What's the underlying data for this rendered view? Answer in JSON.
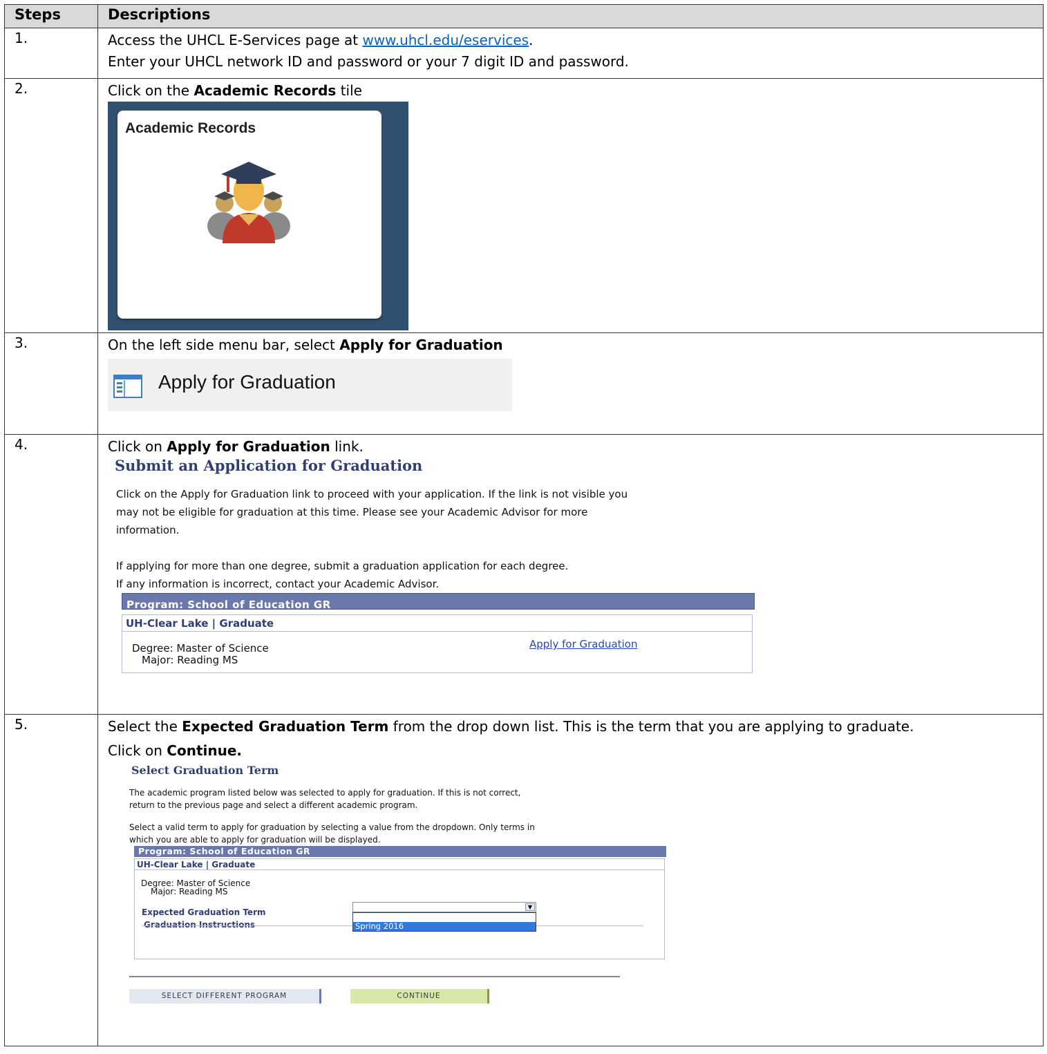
{
  "header": {
    "steps": "Steps",
    "descriptions": "Descriptions"
  },
  "step1": {
    "num": "1.",
    "line1_prefix": "Access the UHCL E-Services page at ",
    "link": "www.uhcl.edu/eservices",
    "line1_suffix": ".",
    "line2": "Enter your UHCL network ID and password or your 7 digit ID and password."
  },
  "step2": {
    "num": "2.",
    "prefix": "Click on the ",
    "bold": "Academic Records",
    "suffix": " tile",
    "tile_title": "Academic Records"
  },
  "step3": {
    "num": "3.",
    "prefix": "On the left side menu bar, select ",
    "bold": "Apply for Graduation",
    "menu_item": "Apply for Graduation"
  },
  "step4": {
    "num": "4.",
    "prefix": "Click on ",
    "bold": "Apply for Graduation",
    "suffix": " link.",
    "page_title": "Submit an Application for Graduation",
    "para1_l1": "Click on the Apply for Graduation link to proceed with your application. If the link is not visible you",
    "para1_l2": "may not be eligible for graduation at this time. Please see your Academic Advisor for more",
    "para1_l3": "information.",
    "para2_l1": "If applying for more than one degree, submit a graduation application for each degree.",
    "para2_l2": "If any information is incorrect, contact your Academic Advisor.",
    "program": "Program: School of Education GR",
    "institution": "UH-Clear Lake | Graduate",
    "degree": "Degree: Master of Science",
    "major": "Major: Reading MS",
    "apply_link": "Apply for Graduation"
  },
  "step5": {
    "num": "5.",
    "prefix": "Select the ",
    "bold": "Expected Graduation Term",
    "suffix": " from the drop down list. This is the term that you are applying to graduate.",
    "line2_prefix": "Click on ",
    "line2_bold": "Continue.",
    "page_title": "Select Graduation Term",
    "para1_l1": "The academic program listed below was selected to apply for graduation. If this is not correct,",
    "para1_l2": "return to the previous page and select a different academic program.",
    "para2_l1": "Select a valid term to apply for graduation by selecting a value from the dropdown. Only terms in",
    "para2_l2": "which you are able to apply for graduation will be displayed.",
    "program": "Program: School of Education GR",
    "institution": "UH-Clear Lake | Graduate",
    "degree": "Degree: Master of Science",
    "major": "Major: Reading MS",
    "term_label": "Expected Graduation Term",
    "instructions_label": "Graduation Instructions",
    "dropdown_value": "",
    "dropdown_option": "Spring 2016",
    "btn_select_program": "Select Different Program",
    "btn_continue": "Continue"
  },
  "colors": {
    "tile_bg": "#30506f",
    "ps_blue": "#2f3f74",
    "program_bar": "#6b78ab",
    "link": "#0563c1"
  }
}
